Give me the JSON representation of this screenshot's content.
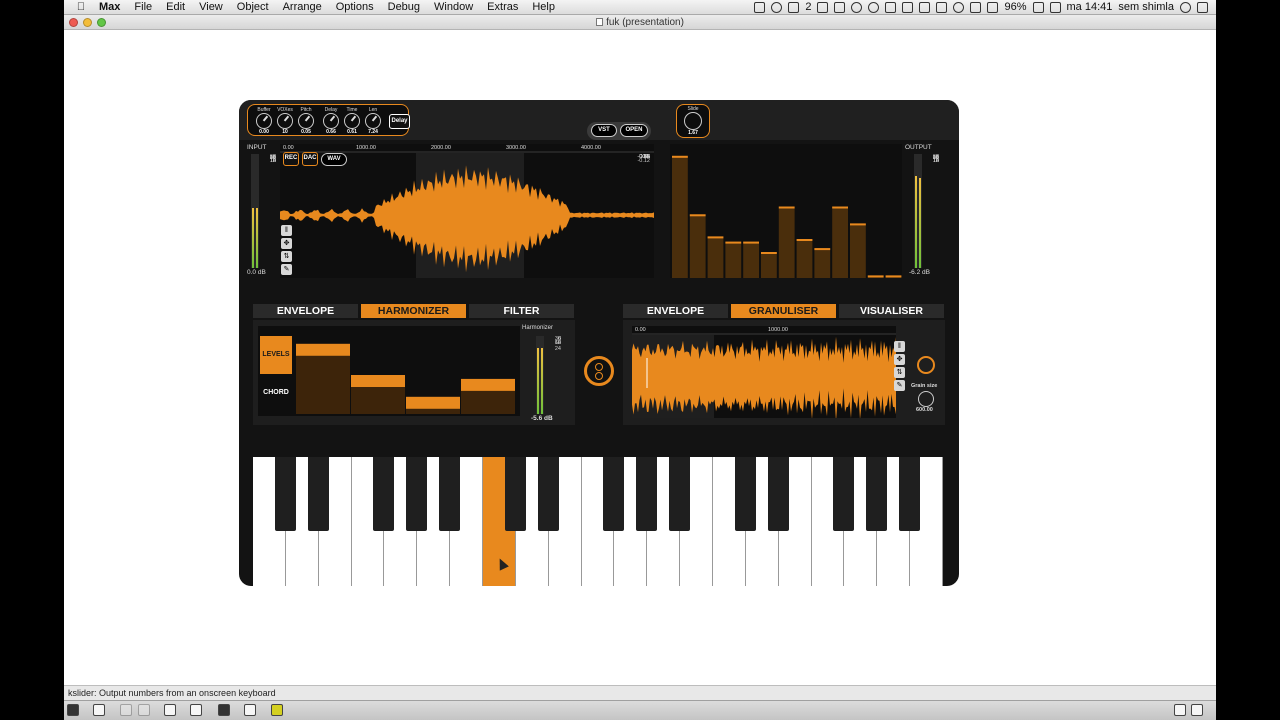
{
  "menubar": {
    "app": "Max",
    "items": [
      "File",
      "Edit",
      "View",
      "Object",
      "Arrange",
      "Options",
      "Debug",
      "Window",
      "Extras",
      "Help"
    ],
    "tray_badge": "2",
    "battery": "96%",
    "clock": "ma 14:41",
    "user": "sem shimla"
  },
  "window": {
    "title": "fuk (presentation)"
  },
  "controls": {
    "knobs": [
      {
        "label": "Buffer",
        "value": "0.00"
      },
      {
        "label": "VOXes",
        "value": "10"
      },
      {
        "label": "Pitch",
        "value": "0.05"
      },
      {
        "label": "Delay",
        "value": "0.66"
      },
      {
        "label": "Time",
        "value": "0.61"
      },
      {
        "label": "Len",
        "value": "7.24"
      }
    ],
    "delay_button": "Delay",
    "vst_button": "VST",
    "open_button": "OPEN",
    "slide_label": "Slide",
    "slide_value": "1.67"
  },
  "input": {
    "label": "INPUT",
    "db": "0.0 dB",
    "scale": [
      "6",
      "0",
      "6",
      "12",
      "18",
      "24",
      "36",
      "48",
      "60"
    ],
    "rec": "REC",
    "dac": "DAC",
    "wav": "WAV",
    "time_ticks": [
      "0.00",
      "1000.00",
      "2000.00",
      "3000.00",
      "4000.00"
    ],
    "amp_ticks": [
      "1",
      "0.88",
      "0.75",
      "0.62",
      "0.5",
      "0.38",
      "0.25",
      "0.12",
      "-0.12",
      "-0.25",
      "-0.38",
      "-0.5",
      "-0.62",
      "-0.75",
      "-0.88"
    ]
  },
  "output": {
    "label": "OUTPUT",
    "db": "-6.2 dB",
    "scale": [
      "6",
      "0",
      "6",
      "12",
      "18",
      "24",
      "36",
      "48",
      "60"
    ],
    "spectrum_levels": [
      0.94,
      0.49,
      0.32,
      0.28,
      0.28,
      0.2,
      0.55,
      0.3,
      0.23,
      0.55,
      0.42,
      0.02,
      0.02
    ]
  },
  "left_tabs": [
    "ENVELOPE",
    "HARMONIZER",
    "FILTER"
  ],
  "left_active": 1,
  "right_tabs": [
    "ENVELOPE",
    "GRANULISER",
    "VISUALISER"
  ],
  "right_active": 1,
  "harmonizer": {
    "levels_btn": "LEVELS",
    "chord_btn": "CHORD",
    "meter_label": "Harmonizer",
    "db": "-5.6 dB",
    "scale": [
      "6",
      "0",
      "6",
      "12",
      "24",
      "36",
      "60"
    ],
    "bar_levels": [
      0.9,
      0.5,
      0.22,
      0.45
    ]
  },
  "granuliser": {
    "time_ticks": [
      "0.00",
      "1000.00"
    ],
    "grain_label": "Grain size",
    "grain_value": "600.00"
  },
  "keyboard": {
    "white_keys": 21,
    "active_white": 7
  },
  "status": {
    "text": "kslider: Output numbers from an onscreen keyboard"
  }
}
